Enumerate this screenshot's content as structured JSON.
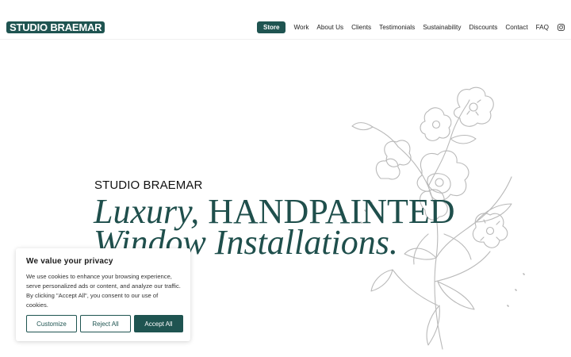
{
  "header": {
    "logo": "STUDIO BRAEMAR",
    "store_label": "Store",
    "nav": [
      "Work",
      "About Us",
      "Clients",
      "Testimonials",
      "Sustainability",
      "Discounts",
      "Contact",
      "FAQ"
    ],
    "social_icon": "instagram-icon"
  },
  "hero": {
    "brand": "STUDIO BRAEMAR",
    "line1_italic": "Luxury,",
    "line1_rest": " HANDPAINTED",
    "line2": "Window Installations.",
    "art_icon": "flower-illustration"
  },
  "cookie": {
    "title": "We value your privacy",
    "text": "We use cookies to enhance your browsing experience, serve personalized ads or content, and analyze our traffic. By clicking \"Accept All\", you consent to our use of cookies.",
    "customize": "Customize",
    "reject": "Reject All",
    "accept": "Accept All"
  },
  "colors": {
    "brand": "#1f5451",
    "hero_text": "#1f4f4c"
  }
}
